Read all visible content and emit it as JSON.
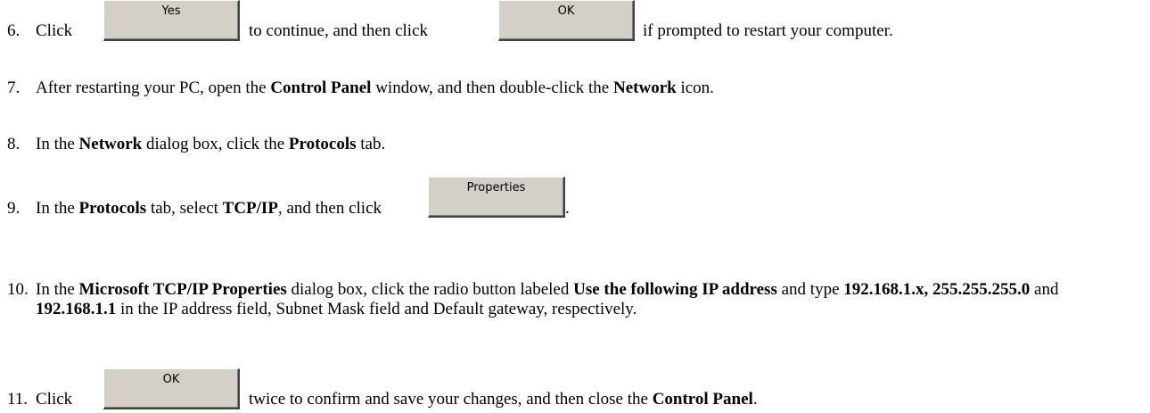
{
  "steps": {
    "s6": {
      "num": "6.",
      "pre": "Click",
      "btn1": "Yes",
      "mid": "to continue, and then click",
      "btn2": "OK",
      "post": "if prompted to restart your computer."
    },
    "s7": {
      "num": "7.",
      "a": "After restarting your PC, open the ",
      "b1": "Control Panel",
      "c": " window, and then double-click the ",
      "b2": "Network",
      "d": " icon."
    },
    "s8": {
      "num": "8.",
      "a": "In the ",
      "b1": "Network",
      "c": " dialog box, click the ",
      "b2": "Protocols",
      "d": " tab."
    },
    "s9": {
      "num": "9.",
      "a": "In the ",
      "b1": "Protocols",
      "c": " tab, select ",
      "b2": "TCP/IP",
      "d": ", and then click",
      "btn": "Properties",
      "e": "."
    },
    "s10": {
      "num": "10.",
      "a": "In the ",
      "b1": "Microsoft TCP/IP Properties",
      "c": " dialog box, click the radio button labeled ",
      "b2": "Use the following IP address",
      "d": " and type ",
      "b3": "192.168.1.x, 255.255.255.0",
      "e": " and ",
      "b4": "192.168.1.1",
      "f": " in the IP address field, Subnet Mask field and Default gateway, respectively."
    },
    "s11": {
      "num": "11.",
      "pre": "Click",
      "btn": "OK",
      "post": "twice to confirm and save your changes, and then close the ",
      "b1": "Control Panel",
      "end": "."
    }
  }
}
